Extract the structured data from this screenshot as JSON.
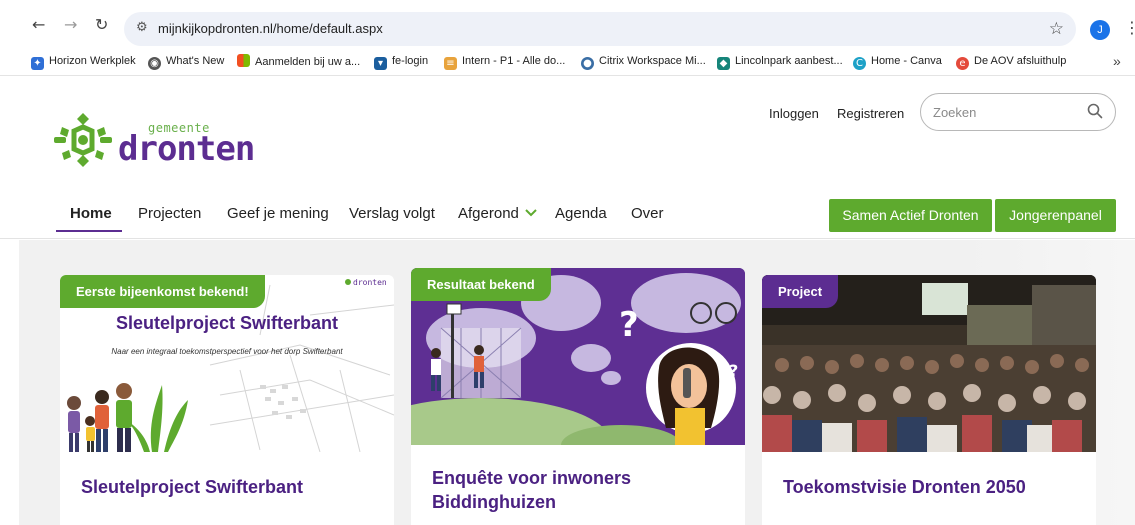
{
  "browser": {
    "url": "mijnkijkopdronten.nl/home/default.aspx",
    "profile_initial": "J",
    "bookmarks": [
      {
        "label": "Horizon Werkplek"
      },
      {
        "label": "What's New"
      },
      {
        "label": "Aanmelden bij uw a..."
      },
      {
        "label": "fe-login"
      },
      {
        "label": "Intern - P1 - Alle do..."
      },
      {
        "label": "Citrix Workspace Mi..."
      },
      {
        "label": "Lincolnpark aanbest..."
      },
      {
        "label": "Home - Canva"
      },
      {
        "label": "De AOV afsluithulp"
      }
    ],
    "more": "»"
  },
  "site": {
    "logo_small": "gemeente",
    "logo_big": "dronten",
    "login": "Inloggen",
    "register": "Registreren",
    "search_placeholder": "Zoeken",
    "nav": [
      "Home",
      "Projecten",
      "Geef je mening",
      "Verslag volgt",
      "Afgerond",
      "Agenda",
      "Over"
    ],
    "buttons": [
      "Samen Actief Dronten",
      "Jongerenpanel"
    ],
    "accent": "#5c2d91",
    "green": "#5eaa2e"
  },
  "cards": [
    {
      "tag": "Eerste bijeenkomst bekend!",
      "image_title": "Sleutelproject Swifterbant",
      "image_subtitle": "Naar een integraal toekomstperspectief voor het dorp Swifterbant",
      "image_logo": "dronten",
      "title": "Sleutelproject Swifterbant"
    },
    {
      "tag": "Resultaat bekend",
      "title_line1": "Enquête voor inwoners",
      "title_line2": "Biddinghuizen"
    },
    {
      "tag": "Project",
      "title": "Toekomstvisie Dronten 2050"
    }
  ]
}
